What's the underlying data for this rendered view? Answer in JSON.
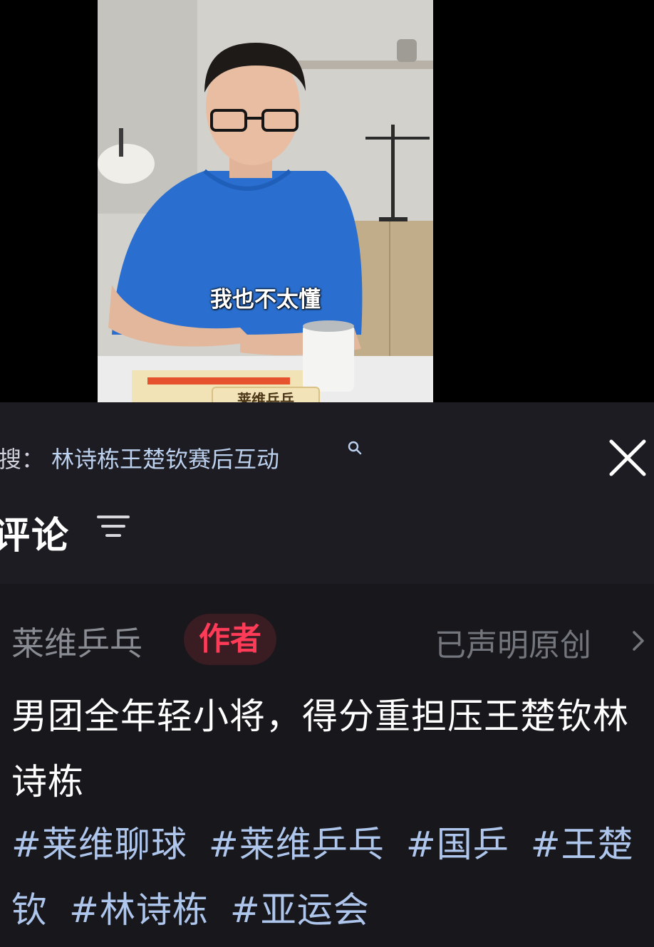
{
  "video": {
    "caption": "我也不太懂",
    "bottom_tag": "莱维乒乓"
  },
  "search": {
    "prefix": "搜：",
    "query": "林诗栋王楚钦赛后互动",
    "icon": "search-icon"
  },
  "comments_header": {
    "title": "评论",
    "filter_icon": "filter-icon",
    "close_icon": "close-icon"
  },
  "comment": {
    "author": "莱维乒乓",
    "badge": "作者",
    "original_label": "已声明原创",
    "text": "男团全年轻小将，得分重担压王楚钦林诗栋",
    "hashtags": [
      "#莱维聊球",
      "#莱维乒乓",
      "#国乒",
      "#王楚钦",
      "#林诗栋",
      "#亚运会"
    ]
  },
  "colors": {
    "panel_bg": "#1c1c22",
    "hashtag": "#aec5ec",
    "badge_text": "#ff3b58",
    "badge_bg": "#3a1c23"
  }
}
